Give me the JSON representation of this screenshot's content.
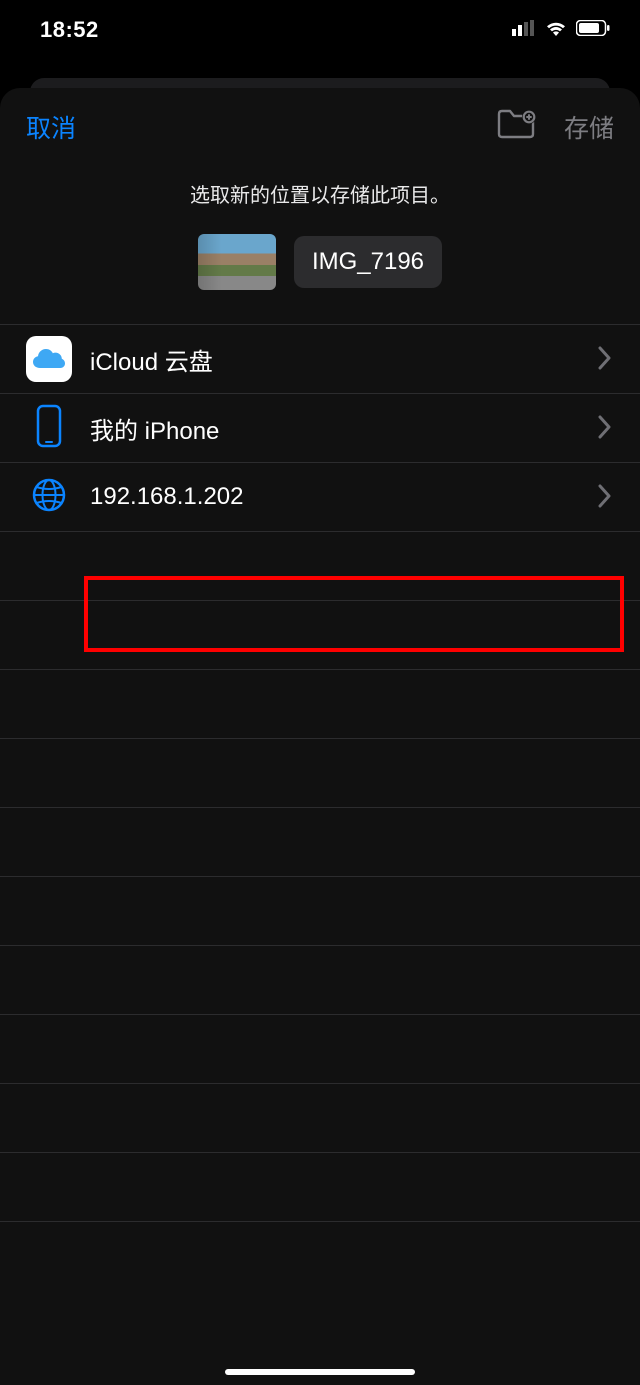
{
  "statusbar": {
    "time": "18:52"
  },
  "toolbar": {
    "cancel_label": "取消",
    "save_label": "存储"
  },
  "subtitle": "选取新的位置以存储此项目。",
  "file": {
    "name": "IMG_7196"
  },
  "locations": [
    {
      "label": "iCloud 云盘",
      "icon": "icloud"
    },
    {
      "label": "我的 iPhone",
      "icon": "iphone"
    },
    {
      "label": "192.168.1.202",
      "icon": "globe",
      "highlighted": true
    }
  ]
}
